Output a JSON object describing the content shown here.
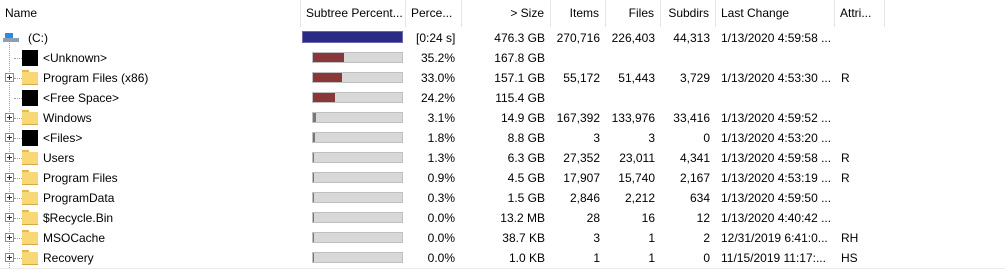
{
  "columns": {
    "name": "Name",
    "subtree": "Subtree Percent...",
    "perce": "Perce...",
    "size": "> Size",
    "items": "Items",
    "files": "Files",
    "subdirs": "Subdirs",
    "last_change": "Last Change",
    "attri": "Attri..."
  },
  "root": {
    "name": "(C:)",
    "subtree_text": "[0:24 s]",
    "size": "476.3 GB",
    "items": "270,716",
    "files": "226,403",
    "subdirs": "44,313",
    "last_change": "1/13/2020  4:59:58 ..."
  },
  "rows": [
    {
      "name": "<Unknown>",
      "icon": "black-square-icon",
      "expandable": false,
      "percent_value": 0.352,
      "percent": "35.2%",
      "size": "167.8 GB",
      "items": "",
      "files": "",
      "subdirs": "",
      "last_change": "",
      "attr": ""
    },
    {
      "name": "Program Files (x86)",
      "icon": "folder-icon",
      "expandable": true,
      "percent_value": 0.33,
      "percent": "33.0%",
      "size": "157.1 GB",
      "items": "55,172",
      "files": "51,443",
      "subdirs": "3,729",
      "last_change": "1/13/2020  4:53:30 ...",
      "attr": "R"
    },
    {
      "name": "<Free Space>",
      "icon": "black-square-icon",
      "expandable": false,
      "percent_value": 0.242,
      "percent": "24.2%",
      "size": "115.4 GB",
      "items": "",
      "files": "",
      "subdirs": "",
      "last_change": "",
      "attr": ""
    },
    {
      "name": "Windows",
      "icon": "folder-icon",
      "expandable": true,
      "percent_value": 0.031,
      "percent": "3.1%",
      "size": "14.9 GB",
      "items": "167,392",
      "files": "133,976",
      "subdirs": "33,416",
      "last_change": "1/13/2020  4:59:52 ...",
      "attr": ""
    },
    {
      "name": "<Files>",
      "icon": "black-square-icon",
      "expandable": true,
      "percent_value": 0.018,
      "percent": "1.8%",
      "size": "8.8 GB",
      "items": "3",
      "files": "3",
      "subdirs": "0",
      "last_change": "1/13/2020  4:53:20 ...",
      "attr": ""
    },
    {
      "name": "Users",
      "icon": "folder-icon",
      "expandable": true,
      "percent_value": 0.013,
      "percent": "1.3%",
      "size": "6.3 GB",
      "items": "27,352",
      "files": "23,011",
      "subdirs": "4,341",
      "last_change": "1/13/2020  4:59:58 ...",
      "attr": "R"
    },
    {
      "name": "Program Files",
      "icon": "folder-icon",
      "expandable": true,
      "percent_value": 0.009,
      "percent": "0.9%",
      "size": "4.5 GB",
      "items": "17,907",
      "files": "15,740",
      "subdirs": "2,167",
      "last_change": "1/13/2020  4:53:19 ...",
      "attr": "R"
    },
    {
      "name": "ProgramData",
      "icon": "folder-icon",
      "expandable": true,
      "percent_value": 0.003,
      "percent": "0.3%",
      "size": "1.5 GB",
      "items": "2,846",
      "files": "2,212",
      "subdirs": "634",
      "last_change": "1/13/2020  4:59:50 ...",
      "attr": ""
    },
    {
      "name": "$Recycle.Bin",
      "icon": "folder-icon",
      "expandable": true,
      "percent_value": 0.0,
      "percent": "0.0%",
      "size": "13.2 MB",
      "items": "28",
      "files": "16",
      "subdirs": "12",
      "last_change": "1/13/2020  4:40:42 ...",
      "attr": ""
    },
    {
      "name": "MSOCache",
      "icon": "folder-icon",
      "expandable": true,
      "percent_value": 0.0,
      "percent": "0.0%",
      "size": "38.7 KB",
      "items": "3",
      "files": "1",
      "subdirs": "2",
      "last_change": "12/31/2019  6:41:0...",
      "attr": "RH"
    },
    {
      "name": "Recovery",
      "icon": "folder-icon",
      "expandable": true,
      "percent_value": 0.0,
      "percent": "0.0%",
      "size": "1.0 KB",
      "items": "1",
      "files": "1",
      "subdirs": "0",
      "last_change": "11/15/2019  11:17:...",
      "attr": "HS"
    }
  ],
  "colors": {
    "bar_fill": "#883838",
    "root_bar": "#2b2b86",
    "bar_track": "#d8d8d8",
    "folder": "#f8d775"
  }
}
